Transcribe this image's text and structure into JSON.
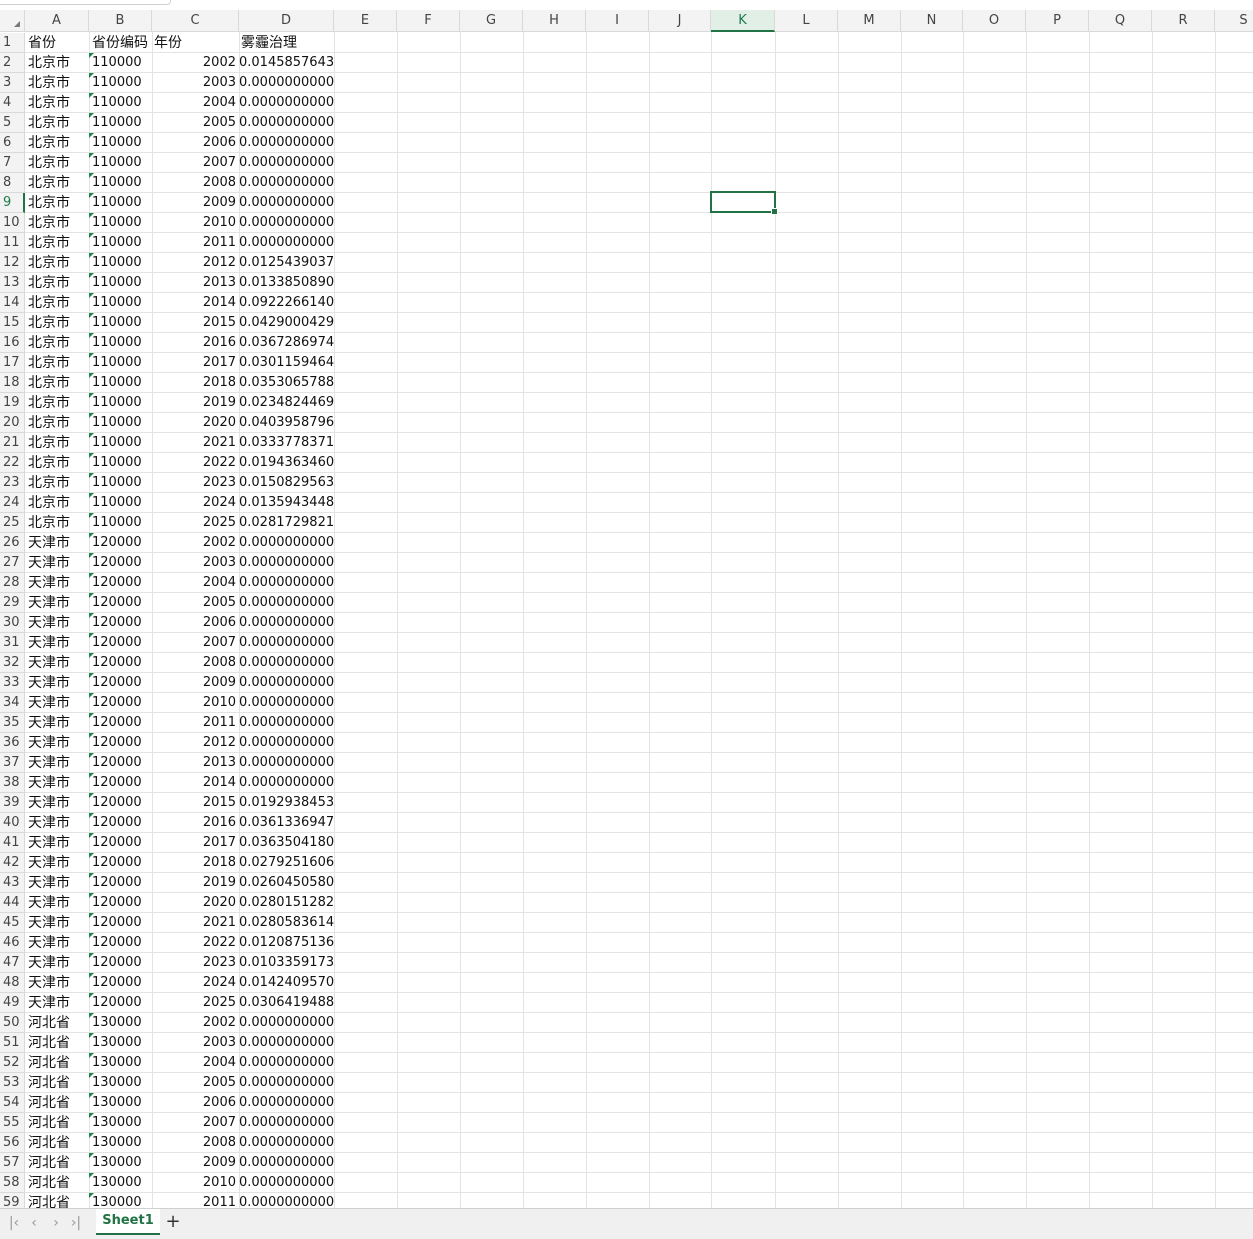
{
  "columns": [
    "A",
    "B",
    "C",
    "D",
    "E",
    "F",
    "G",
    "H",
    "I",
    "J",
    "K",
    "L",
    "M",
    "N",
    "O",
    "P",
    "Q",
    "R",
    "S"
  ],
  "selected_column": "K",
  "selected_row": 9,
  "header_row": {
    "a": "省份",
    "b": "省份编码",
    "c": "年份",
    "d": "雾霾治理"
  },
  "rows": [
    {
      "n": "2",
      "a": "北京市",
      "b": "110000",
      "c": "2002",
      "d": "0.0145857643"
    },
    {
      "n": "3",
      "a": "北京市",
      "b": "110000",
      "c": "2003",
      "d": "0.0000000000"
    },
    {
      "n": "4",
      "a": "北京市",
      "b": "110000",
      "c": "2004",
      "d": "0.0000000000"
    },
    {
      "n": "5",
      "a": "北京市",
      "b": "110000",
      "c": "2005",
      "d": "0.0000000000"
    },
    {
      "n": "6",
      "a": "北京市",
      "b": "110000",
      "c": "2006",
      "d": "0.0000000000"
    },
    {
      "n": "7",
      "a": "北京市",
      "b": "110000",
      "c": "2007",
      "d": "0.0000000000"
    },
    {
      "n": "8",
      "a": "北京市",
      "b": "110000",
      "c": "2008",
      "d": "0.0000000000"
    },
    {
      "n": "9",
      "a": "北京市",
      "b": "110000",
      "c": "2009",
      "d": "0.0000000000"
    },
    {
      "n": "10",
      "a": "北京市",
      "b": "110000",
      "c": "2010",
      "d": "0.0000000000"
    },
    {
      "n": "11",
      "a": "北京市",
      "b": "110000",
      "c": "2011",
      "d": "0.0000000000"
    },
    {
      "n": "12",
      "a": "北京市",
      "b": "110000",
      "c": "2012",
      "d": "0.0125439037"
    },
    {
      "n": "13",
      "a": "北京市",
      "b": "110000",
      "c": "2013",
      "d": "0.0133850890"
    },
    {
      "n": "14",
      "a": "北京市",
      "b": "110000",
      "c": "2014",
      "d": "0.0922266140"
    },
    {
      "n": "15",
      "a": "北京市",
      "b": "110000",
      "c": "2015",
      "d": "0.0429000429"
    },
    {
      "n": "16",
      "a": "北京市",
      "b": "110000",
      "c": "2016",
      "d": "0.0367286974"
    },
    {
      "n": "17",
      "a": "北京市",
      "b": "110000",
      "c": "2017",
      "d": "0.0301159464"
    },
    {
      "n": "18",
      "a": "北京市",
      "b": "110000",
      "c": "2018",
      "d": "0.0353065788"
    },
    {
      "n": "19",
      "a": "北京市",
      "b": "110000",
      "c": "2019",
      "d": "0.0234824469"
    },
    {
      "n": "20",
      "a": "北京市",
      "b": "110000",
      "c": "2020",
      "d": "0.0403958796"
    },
    {
      "n": "21",
      "a": "北京市",
      "b": "110000",
      "c": "2021",
      "d": "0.0333778371"
    },
    {
      "n": "22",
      "a": "北京市",
      "b": "110000",
      "c": "2022",
      "d": "0.0194363460"
    },
    {
      "n": "23",
      "a": "北京市",
      "b": "110000",
      "c": "2023",
      "d": "0.0150829563"
    },
    {
      "n": "24",
      "a": "北京市",
      "b": "110000",
      "c": "2024",
      "d": "0.0135943448"
    },
    {
      "n": "25",
      "a": "北京市",
      "b": "110000",
      "c": "2025",
      "d": "0.0281729821"
    },
    {
      "n": "26",
      "a": "天津市",
      "b": "120000",
      "c": "2002",
      "d": "0.0000000000"
    },
    {
      "n": "27",
      "a": "天津市",
      "b": "120000",
      "c": "2003",
      "d": "0.0000000000"
    },
    {
      "n": "28",
      "a": "天津市",
      "b": "120000",
      "c": "2004",
      "d": "0.0000000000"
    },
    {
      "n": "29",
      "a": "天津市",
      "b": "120000",
      "c": "2005",
      "d": "0.0000000000"
    },
    {
      "n": "30",
      "a": "天津市",
      "b": "120000",
      "c": "2006",
      "d": "0.0000000000"
    },
    {
      "n": "31",
      "a": "天津市",
      "b": "120000",
      "c": "2007",
      "d": "0.0000000000"
    },
    {
      "n": "32",
      "a": "天津市",
      "b": "120000",
      "c": "2008",
      "d": "0.0000000000"
    },
    {
      "n": "33",
      "a": "天津市",
      "b": "120000",
      "c": "2009",
      "d": "0.0000000000"
    },
    {
      "n": "34",
      "a": "天津市",
      "b": "120000",
      "c": "2010",
      "d": "0.0000000000"
    },
    {
      "n": "35",
      "a": "天津市",
      "b": "120000",
      "c": "2011",
      "d": "0.0000000000"
    },
    {
      "n": "36",
      "a": "天津市",
      "b": "120000",
      "c": "2012",
      "d": "0.0000000000"
    },
    {
      "n": "37",
      "a": "天津市",
      "b": "120000",
      "c": "2013",
      "d": "0.0000000000"
    },
    {
      "n": "38",
      "a": "天津市",
      "b": "120000",
      "c": "2014",
      "d": "0.0000000000"
    },
    {
      "n": "39",
      "a": "天津市",
      "b": "120000",
      "c": "2015",
      "d": "0.0192938453"
    },
    {
      "n": "40",
      "a": "天津市",
      "b": "120000",
      "c": "2016",
      "d": "0.0361336947"
    },
    {
      "n": "41",
      "a": "天津市",
      "b": "120000",
      "c": "2017",
      "d": "0.0363504180"
    },
    {
      "n": "42",
      "a": "天津市",
      "b": "120000",
      "c": "2018",
      "d": "0.0279251606"
    },
    {
      "n": "43",
      "a": "天津市",
      "b": "120000",
      "c": "2019",
      "d": "0.0260450580"
    },
    {
      "n": "44",
      "a": "天津市",
      "b": "120000",
      "c": "2020",
      "d": "0.0280151282"
    },
    {
      "n": "45",
      "a": "天津市",
      "b": "120000",
      "c": "2021",
      "d": "0.0280583614"
    },
    {
      "n": "46",
      "a": "天津市",
      "b": "120000",
      "c": "2022",
      "d": "0.0120875136"
    },
    {
      "n": "47",
      "a": "天津市",
      "b": "120000",
      "c": "2023",
      "d": "0.0103359173"
    },
    {
      "n": "48",
      "a": "天津市",
      "b": "120000",
      "c": "2024",
      "d": "0.0142409570"
    },
    {
      "n": "49",
      "a": "天津市",
      "b": "120000",
      "c": "2025",
      "d": "0.0306419488"
    },
    {
      "n": "50",
      "a": "河北省",
      "b": "130000",
      "c": "2002",
      "d": "0.0000000000"
    },
    {
      "n": "51",
      "a": "河北省",
      "b": "130000",
      "c": "2003",
      "d": "0.0000000000"
    },
    {
      "n": "52",
      "a": "河北省",
      "b": "130000",
      "c": "2004",
      "d": "0.0000000000"
    },
    {
      "n": "53",
      "a": "河北省",
      "b": "130000",
      "c": "2005",
      "d": "0.0000000000"
    },
    {
      "n": "54",
      "a": "河北省",
      "b": "130000",
      "c": "2006",
      "d": "0.0000000000"
    },
    {
      "n": "55",
      "a": "河北省",
      "b": "130000",
      "c": "2007",
      "d": "0.0000000000"
    },
    {
      "n": "56",
      "a": "河北省",
      "b": "130000",
      "c": "2008",
      "d": "0.0000000000"
    },
    {
      "n": "57",
      "a": "河北省",
      "b": "130000",
      "c": "2009",
      "d": "0.0000000000"
    },
    {
      "n": "58",
      "a": "河北省",
      "b": "130000",
      "c": "2010",
      "d": "0.0000000000"
    },
    {
      "n": "59",
      "a": "河北省",
      "b": "130000",
      "c": "2011",
      "d": "0.0000000000"
    }
  ],
  "sheet_tabs": [
    "Sheet1"
  ],
  "add_sheet_label": "+",
  "nav_icons": [
    "first-sheet-icon",
    "prev-sheet-icon",
    "next-sheet-icon",
    "last-sheet-icon"
  ],
  "colors": {
    "accent": "#217346",
    "error_indicator": "#1e8449"
  }
}
